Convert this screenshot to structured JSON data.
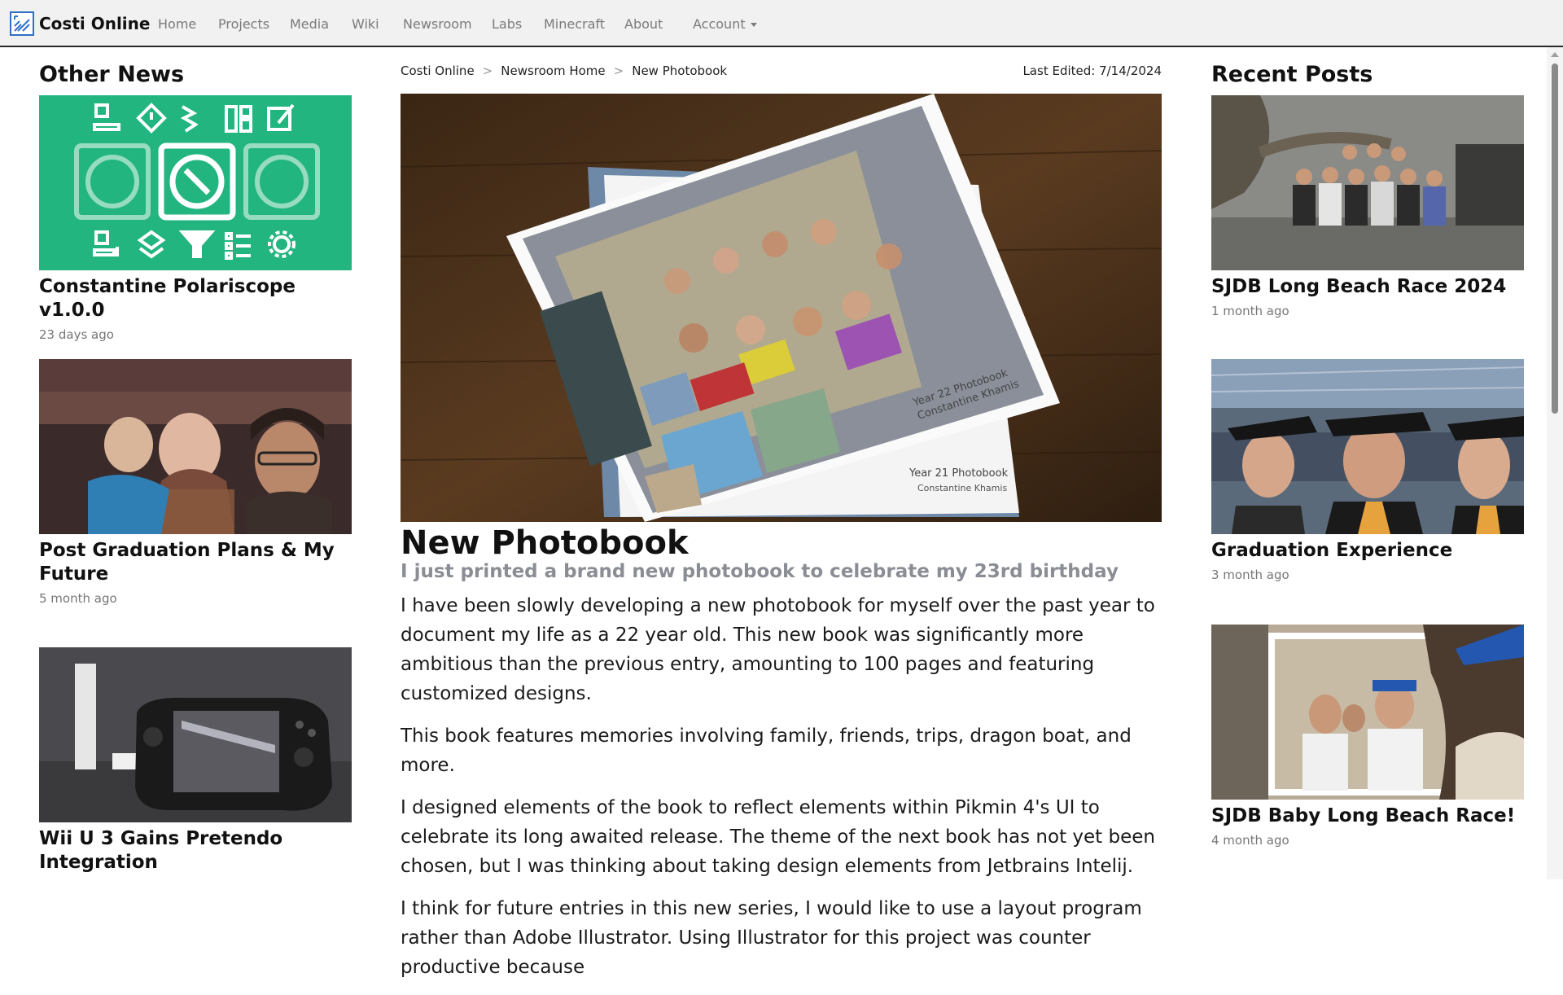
{
  "navbar": {
    "brand": "Costi Online",
    "items": [
      "Home",
      "Projects",
      "Media",
      "Wiki",
      "Newsroom",
      "Labs",
      "Minecraft",
      "About"
    ],
    "account_label": "Account"
  },
  "other_news": {
    "title": "Other News",
    "cards": [
      {
        "title": "Constantine Polariscope v1.0.0",
        "date": "23 days ago"
      },
      {
        "title": "Post Graduation Plans & My Future",
        "date": "5 month ago"
      },
      {
        "title": "Wii U 3 Gains Pretendo Integration",
        "date": ""
      }
    ]
  },
  "recent_posts": {
    "title": "Recent Posts",
    "cards": [
      {
        "title": "SJDB Long Beach Race 2024",
        "date": "1 month ago"
      },
      {
        "title": "Graduation Experience",
        "date": "3 month ago"
      },
      {
        "title": "SJDB Baby Long Beach Race!",
        "date": "4 month ago"
      }
    ]
  },
  "breadcrumb": [
    "Costi Online",
    "Newsroom Home",
    "New Photobook"
  ],
  "last_edited": "Last Edited: 7/14/2024",
  "article": {
    "title": "New Photobook",
    "subtitle": "I just printed a brand new photobook to celebrate my 23rd birthday",
    "paragraphs": [
      "I have been slowly developing a new photobook for myself over the past year to document my life as a 22 year old. This new book was significantly more ambitious than the previous entry, amounting to 100 pages and featuring customized designs.",
      "This book features memories involving family, friends, trips, dragon boat, and more.",
      "I designed elements of the book to reflect elements within Pikmin 4's UI to celebrate its long awaited release. The theme of the next book has not yet been chosen, but I was thinking about taking design elements from Jetbrains Intelij.",
      "I think for future entries in this new series, I would like to use a layout program rather than Adobe Illustrator. Using Illustrator for this project was counter productive because"
    ],
    "book_labels": {
      "top_line1": "Year 22 Photobook",
      "top_line2": "Constantine Khamis",
      "bottom_line1": "Year 21 Photobook",
      "bottom_line2": "Constantine Khamis"
    }
  },
  "colors": {
    "accent_green": "#22b580",
    "navbar_bg": "#f1f1f1",
    "subtitle_gray": "#8a8d94"
  }
}
